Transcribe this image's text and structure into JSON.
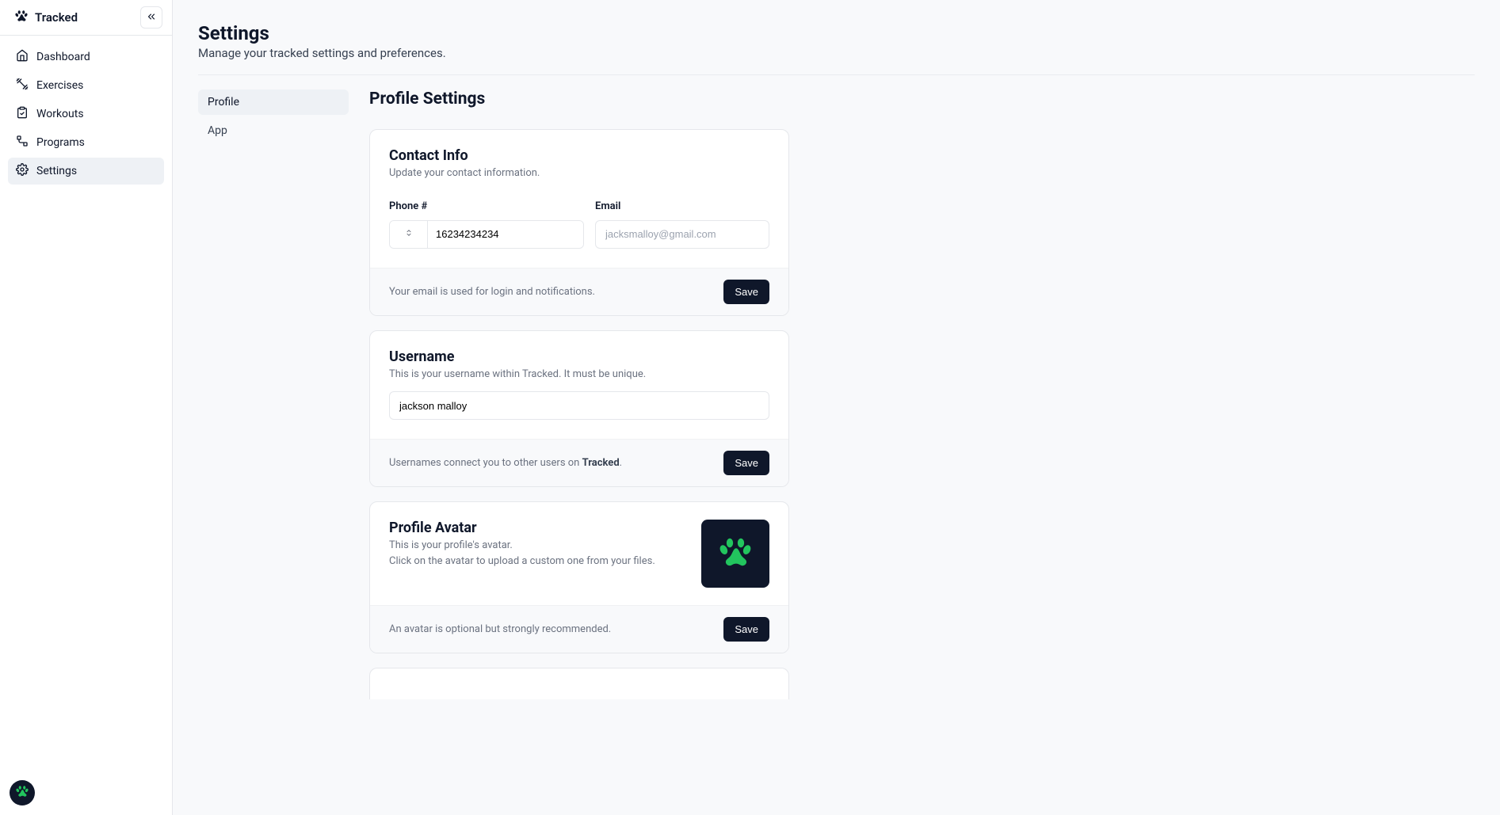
{
  "brand": {
    "name": "Tracked"
  },
  "sidebar": {
    "items": [
      {
        "label": "Dashboard"
      },
      {
        "label": "Exercises"
      },
      {
        "label": "Workouts"
      },
      {
        "label": "Programs"
      },
      {
        "label": "Settings"
      }
    ]
  },
  "page": {
    "title": "Settings",
    "subtitle": "Manage your tracked settings and preferences."
  },
  "settingsNav": {
    "items": [
      {
        "label": "Profile"
      },
      {
        "label": "App"
      }
    ]
  },
  "profile": {
    "section_title": "Profile Settings",
    "contact": {
      "title": "Contact Info",
      "desc": "Update your contact information.",
      "phone_label": "Phone #",
      "phone_value": "16234234234",
      "email_label": "Email",
      "email_placeholder": "jacksmalloy@gmail.com",
      "footer_note": "Your email is used for login and notifications.",
      "save_label": "Save"
    },
    "username": {
      "title": "Username",
      "desc": "This is your username within Tracked. It must be unique.",
      "value": "jackson malloy",
      "footer_note_prefix": "Usernames connect you to other users on ",
      "footer_note_brand": "Tracked",
      "footer_note_suffix": ".",
      "save_label": "Save"
    },
    "avatar": {
      "title": "Profile Avatar",
      "desc_line1": "This is your profile's avatar.",
      "desc_line2": "Click on the avatar to upload a custom one from your files.",
      "footer_note": "An avatar is optional but strongly recommended.",
      "save_label": "Save"
    }
  }
}
